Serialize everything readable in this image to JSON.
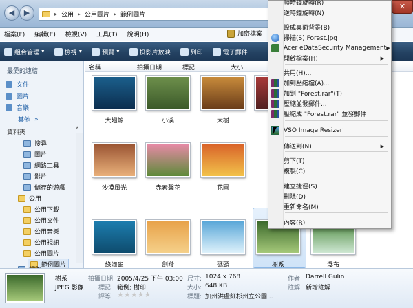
{
  "address": {
    "crumbs": [
      "公用",
      "公用圖片",
      "範例圖片"
    ]
  },
  "menubar": {
    "items": [
      "檔案(F)",
      "編輯(E)",
      "檢視(V)",
      "工具(T)",
      "說明(H)"
    ],
    "encrypt_label": "加密檔案"
  },
  "toolbar": {
    "items": [
      "組合管理",
      "檢視",
      "預覽",
      "投影片放映",
      "列印",
      "電子郵件"
    ]
  },
  "nav": {
    "favorites_header": "最愛的連結",
    "favorites": [
      "文件",
      "圖片",
      "音樂"
    ],
    "more": "其他",
    "folders_header": "資料夾",
    "tree": [
      "搜尋",
      "圖片",
      "網路工具",
      "影片",
      "儲存的遊戲",
      "公用",
      "公用下載",
      "公用文件",
      "公用音樂",
      "公用視訊",
      "公用圖片",
      "範例圖片",
      "網路"
    ]
  },
  "columns": [
    "名稱",
    "拍攝日期",
    "標記",
    "大小"
  ],
  "files": [
    {
      "name": "大翅鯨",
      "colors": [
        "#1b5f8c",
        "#0c2e4f"
      ]
    },
    {
      "name": "小溪",
      "colors": [
        "#6d8f4b",
        "#3c5a2a"
      ]
    },
    {
      "name": "大樹",
      "colors": [
        "#c88b3b",
        "#6b3d1a"
      ]
    },
    {
      "name": "",
      "colors": [
        "#a83a3a",
        "#512020"
      ]
    },
    {
      "name": "沙漠風光",
      "colors": [
        "#9b5634",
        "#e9b07a"
      ]
    },
    {
      "name": "赤素馨花",
      "colors": [
        "#e58aa5",
        "#5e8a3a"
      ]
    },
    {
      "name": "花園",
      "colors": [
        "#d9642a",
        "#f2c24a"
      ]
    },
    {
      "name": "綠海龜",
      "colors": [
        "#1d7dae",
        "#0e4b6d"
      ]
    },
    {
      "name": "劍羚",
      "colors": [
        "#e8a24a",
        "#f5d08a"
      ]
    },
    {
      "name": "碼頭",
      "colors": [
        "#5aa7d8",
        "#dff2fb"
      ]
    },
    {
      "name": "瀑布",
      "colors": [
        "#4c8a3e",
        "#cfe8d4"
      ]
    },
    {
      "name": "樹系",
      "colors": [
        "#3c6a2c",
        "#a6c97a"
      ]
    }
  ],
  "details": {
    "name": "樹系",
    "type": "JPEG 影像",
    "date_label": "拍攝日期:",
    "date_value": "2005/4/25 下午 03:00",
    "tags_label": "標記:",
    "tags_value": "範例; 樹印",
    "rating_label": "評等:",
    "rating_stars": 0,
    "dim_label": "尺寸:",
    "dim_value": "1024 x 768",
    "size_label": "大小:",
    "size_value": "648 KB",
    "title_label": "標題:",
    "title_value": "加州洪盧紅杉州立公園...",
    "author_label": "作者:",
    "author_value": "Darrell Gulin",
    "comment_label": "註解:",
    "comment_value": "新增註解"
  },
  "context_menu": {
    "items": [
      {
        "label": "順時鐘旋轉(R)",
        "icon": "none"
      },
      {
        "label": "逆時鐘旋轉(N)",
        "icon": "none"
      },
      {
        "label": "設成桌面背景(B)",
        "icon": "none"
      },
      {
        "label": "掃描(S) Forest.jpg",
        "icon": "globe"
      },
      {
        "label": "Acer eDataSecurity Management",
        "icon": "acer",
        "submenu": true
      },
      {
        "label": "開啟檔案(H)",
        "icon": "none",
        "submenu": true
      },
      {
        "label": "共用(H)...",
        "icon": "none"
      },
      {
        "label": "加到壓縮檔(A)...",
        "icon": "rar"
      },
      {
        "label": "加到 \"Forest.rar\"(T)",
        "icon": "rar"
      },
      {
        "label": "壓縮並發郵件...",
        "icon": "rar"
      },
      {
        "label": "壓縮成 \"Forest.rar\" 並發郵件",
        "icon": "rar"
      },
      {
        "label": "VSO Image Resizer",
        "icon": "vso"
      },
      {
        "label": "傳送到(N)",
        "icon": "none",
        "submenu": true
      },
      {
        "label": "剪下(T)",
        "icon": "none"
      },
      {
        "label": "複製(C)",
        "icon": "none"
      },
      {
        "label": "建立捷徑(S)",
        "icon": "none"
      },
      {
        "label": "刪除(D)",
        "icon": "none"
      },
      {
        "label": "重新命名(M)",
        "icon": "none"
      },
      {
        "label": "內容(R)",
        "icon": "none"
      }
    ]
  },
  "window": {
    "close_symbol": "✕"
  }
}
